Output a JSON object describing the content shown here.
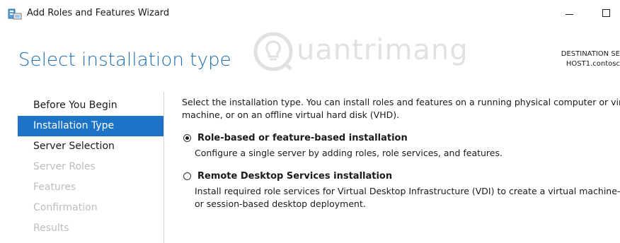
{
  "window": {
    "title": "Add Roles and Features Wizard",
    "icon": "server-manager-icon"
  },
  "header": {
    "page_title": "Select installation type",
    "destination_label": "DESTINATION SE",
    "destination_server": "HOST1.contosc"
  },
  "watermark": {
    "text": "uantrimang"
  },
  "sidebar": {
    "items": [
      {
        "label": "Before You Begin",
        "state": "normal"
      },
      {
        "label": "Installation Type",
        "state": "active"
      },
      {
        "label": "Server Selection",
        "state": "normal"
      },
      {
        "label": "Server Roles",
        "state": "disabled"
      },
      {
        "label": "Features",
        "state": "disabled"
      },
      {
        "label": "Confirmation",
        "state": "disabled"
      },
      {
        "label": "Results",
        "state": "disabled"
      }
    ]
  },
  "content": {
    "intro_line1": "Select the installation type. You can install roles and features on a running physical computer or vir",
    "intro_line2": "machine, or on an offline virtual hard disk (VHD).",
    "options": [
      {
        "title": "Role-based or feature-based installation",
        "desc_line1": "Configure a single server by adding roles, role services, and features.",
        "desc_line2": "",
        "selected": true
      },
      {
        "title": "Remote Desktop Services installation",
        "desc_line1": "Install required role services for Virtual Desktop Infrastructure (VDI) to create a virtual machine-",
        "desc_line2": "or session-based desktop deployment.",
        "selected": false
      }
    ]
  },
  "colors": {
    "title_blue": "#1c6fb3",
    "active_nav": "#1d73c5",
    "disabled_text": "#bdbdbd"
  }
}
